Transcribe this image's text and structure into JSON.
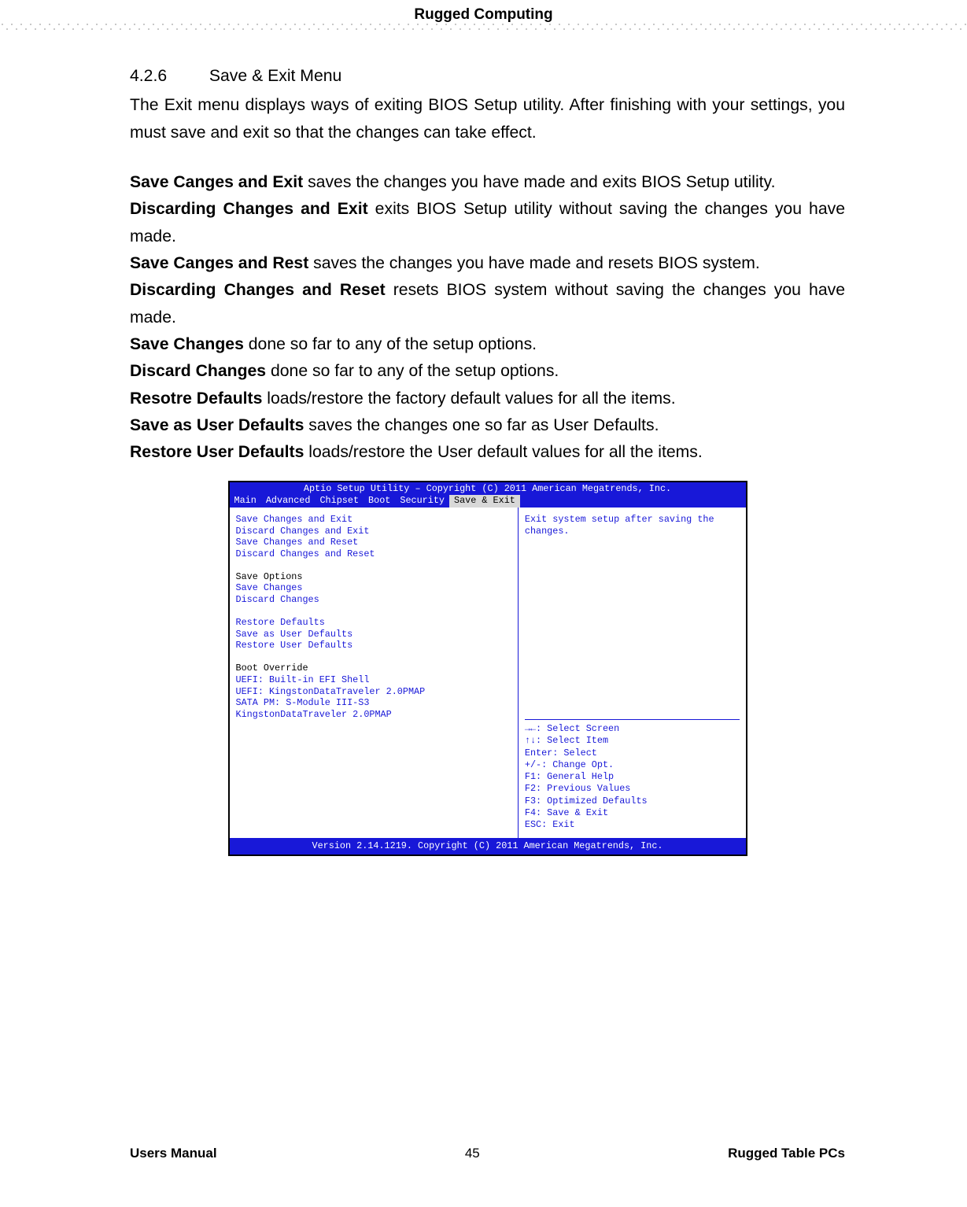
{
  "header": {
    "title": "Rugged Computing"
  },
  "section": {
    "number": "4.2.6",
    "title": "Save & Exit Menu",
    "intro": "The Exit menu displays ways of exiting BIOS Setup utility. After finishing with your settings, you must save and exit so that the changes can take effect."
  },
  "items": [
    {
      "bold": "Save Canges and Exit",
      "text": " saves the changes you have made and exits BIOS Setup utility."
    },
    {
      "bold": "Discarding Changes and Exit",
      "text": " exits BIOS Setup utility without saving the changes you have made."
    },
    {
      "bold": "Save Canges and Rest",
      "text": " saves the changes you have made and resets BIOS system."
    },
    {
      "bold": "Discarding Changes and Reset",
      "text": " resets BIOS system without saving the changes you have made."
    },
    {
      "bold": "Save Changes",
      "text": " done so far to any of the setup options."
    },
    {
      "bold": "Discard Changes",
      "text": " done so far to any of the setup options."
    },
    {
      "bold": "Resotre Defaults",
      "text": " loads/restore the factory default values for all the items."
    },
    {
      "bold": "Save as User Defaults",
      "text": " saves the changes one so far as User Defaults."
    },
    {
      "bold": "Restore User Defaults",
      "text": " loads/restore the User default values for all the items."
    }
  ],
  "bios": {
    "titlebar": "Aptio Setup Utility – Copyright (C) 2011 American Megatrends, Inc.",
    "tabs": [
      "Main",
      "Advanced",
      "Chipset",
      "Boot",
      "Security",
      "Save & Exit"
    ],
    "selected_tab_index": 5,
    "left": {
      "group1": [
        "Save Changes and Exit",
        "Discard Changes and Exit",
        "Save Changes and Reset",
        "Discard Changes and Reset"
      ],
      "group2_header": "Save Options",
      "group2": [
        "Save Changes",
        "Discard Changes"
      ],
      "group3": [
        "Restore Defaults",
        "Save as User Defaults",
        "Restore User Defaults"
      ],
      "group4_header": "Boot Override",
      "group4": [
        "UEFI: Built-in EFI Shell",
        "UEFI: KingstonDataTraveler 2.0PMAP",
        "SATA  PM: S-Module III-S3",
        "KingstonDataTraveler 2.0PMAP"
      ]
    },
    "right": {
      "help_text": "Exit system setup after saving the changes.",
      "keys": [
        "→←: Select Screen",
        "↑↓: Select Item",
        "Enter: Select",
        "+/-: Change Opt.",
        "F1: General Help",
        "F2: Previous Values",
        "F3: Optimized Defaults",
        "F4: Save & Exit",
        "ESC: Exit"
      ]
    },
    "footer": "Version 2.14.1219. Copyright (C) 2011 American Megatrends, Inc."
  },
  "footer": {
    "left": "Users Manual",
    "center": "45",
    "right": "Rugged Table PCs"
  }
}
